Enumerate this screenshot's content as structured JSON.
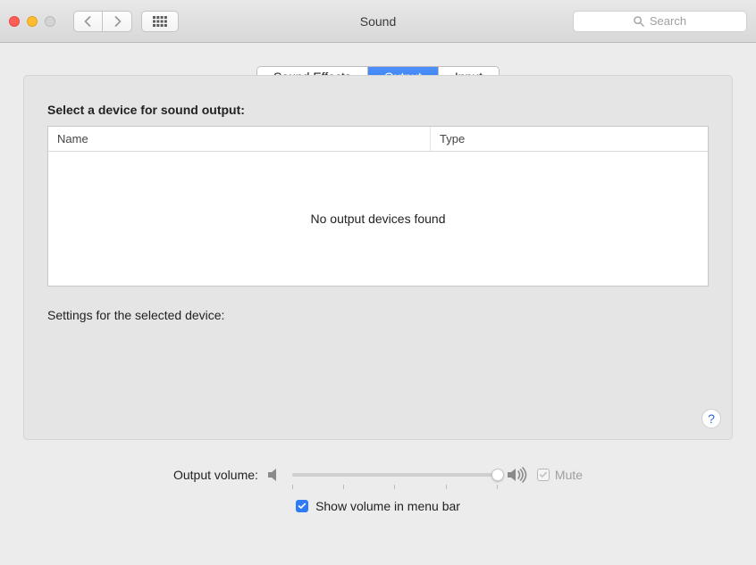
{
  "window": {
    "title": "Sound"
  },
  "toolbar": {
    "search_placeholder": "Search"
  },
  "tabs": {
    "sound_effects": "Sound Effects",
    "output": "Output",
    "input": "Input",
    "active": "output"
  },
  "main": {
    "select_device_label": "Select a device for sound output:",
    "table_headers": {
      "name": "Name",
      "type": "Type"
    },
    "empty_message": "No output devices found",
    "settings_label": "Settings for the selected device:",
    "help": "?"
  },
  "volume": {
    "label": "Output volume:",
    "mute_label": "Mute",
    "mute_checked": true,
    "mute_disabled": true,
    "slider_value": 100
  },
  "menubar": {
    "show_label": "Show volume in menu bar",
    "checked": true
  }
}
